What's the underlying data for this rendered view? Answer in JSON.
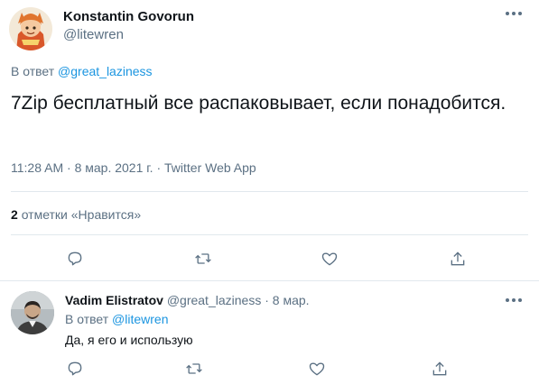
{
  "tweet": {
    "author_name": "Konstantin Govorun",
    "author_handle": "@litewren",
    "reply_prefix": "В ответ",
    "reply_to": "@great_laziness",
    "text": "7Zip бесплатный все распаковывает, если понадобится.",
    "time": "11:28 AM",
    "date": "8 мар. 2021 г.",
    "source": "Twitter Web App",
    "likes_count": "2",
    "likes_label": "отметки «Нравится»",
    "separator": "·"
  },
  "reply": {
    "author_name": "Vadim Elistratov",
    "author_handle": "@great_laziness",
    "date": "8 мар.",
    "reply_prefix": "В ответ",
    "reply_to": "@litewren",
    "text": "Да, я его и использую"
  },
  "colors": {
    "link": "#1b95e0",
    "secondary_text": "#5b7083",
    "primary_text": "#0f1419",
    "divider": "#e1e8ed"
  },
  "icons": [
    "more-icon",
    "reply-icon",
    "retweet-icon",
    "like-icon",
    "share-icon"
  ]
}
